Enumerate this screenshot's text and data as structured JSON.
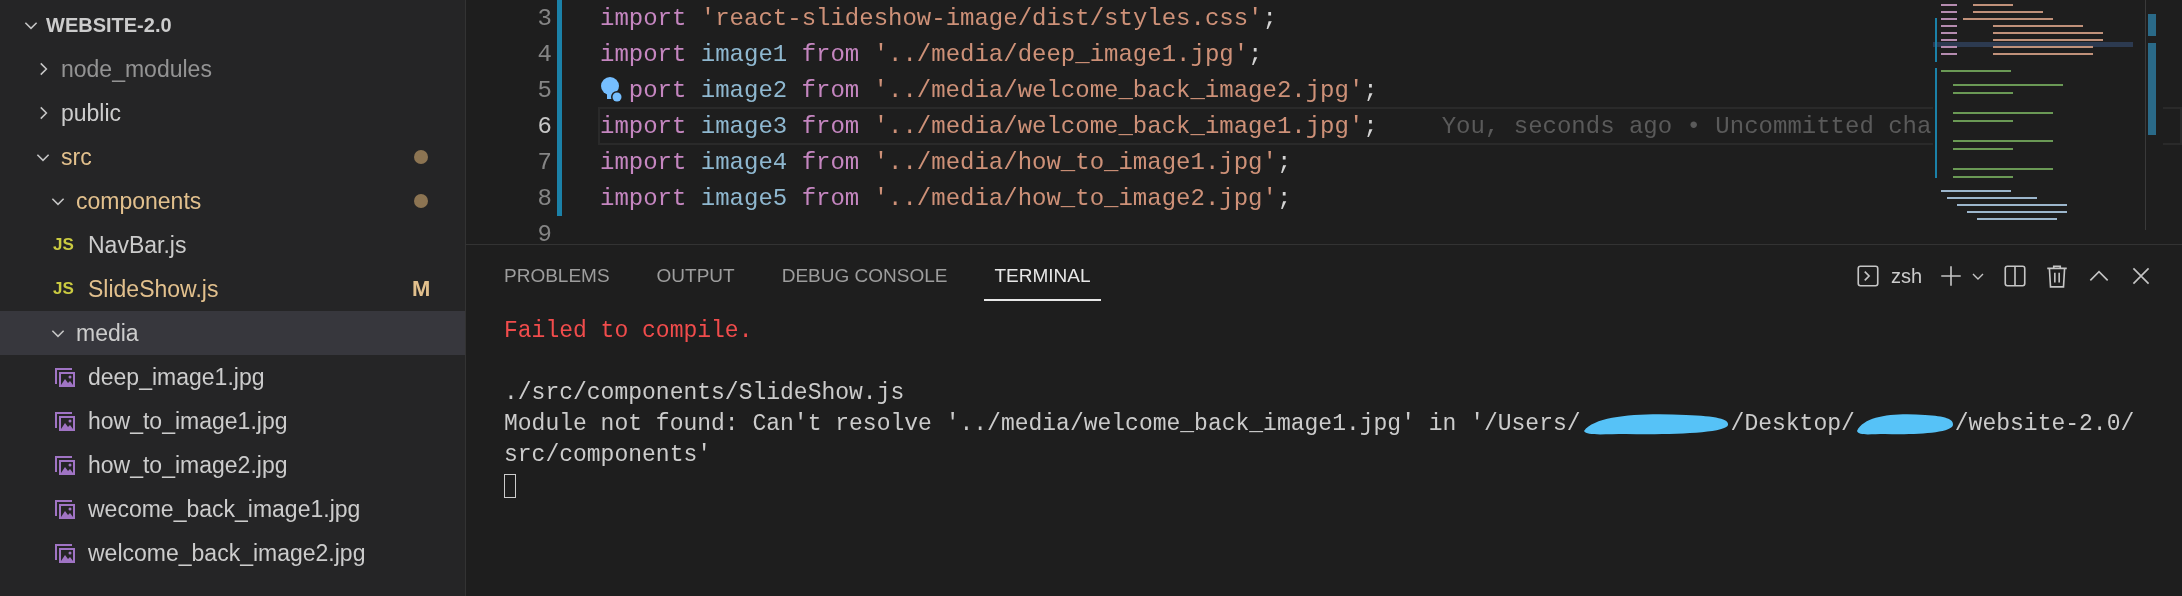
{
  "explorer": {
    "title": "WEBSITE-2.0",
    "expanded": true,
    "items": [
      {
        "name": "node_modules",
        "kind": "folder",
        "expanded": false,
        "ignored": true,
        "modified": false,
        "selected": false
      },
      {
        "name": "public",
        "kind": "folder",
        "expanded": false,
        "ignored": false,
        "modified": false,
        "selected": false
      },
      {
        "name": "src",
        "kind": "folder",
        "expanded": true,
        "ignored": false,
        "modified": true,
        "selected": false,
        "children": [
          {
            "name": "components",
            "kind": "folder",
            "expanded": true,
            "ignored": false,
            "modified": true,
            "selected": false,
            "children": [
              {
                "name": "NavBar.js",
                "kind": "js",
                "icon_label": "JS",
                "ignored": false,
                "modified": false,
                "selected": false
              },
              {
                "name": "SlideShow.js",
                "kind": "js",
                "icon_label": "JS",
                "ignored": false,
                "modified": true,
                "badge": "M",
                "selected": false
              }
            ]
          },
          {
            "name": "media",
            "kind": "folder",
            "expanded": true,
            "ignored": false,
            "modified": false,
            "selected": true,
            "children": [
              {
                "name": "deep_image1.jpg",
                "kind": "image",
                "ignored": false,
                "modified": false,
                "selected": false
              },
              {
                "name": "how_to_image1.jpg",
                "kind": "image",
                "ignored": false,
                "modified": false,
                "selected": false
              },
              {
                "name": "how_to_image2.jpg",
                "kind": "image",
                "ignored": false,
                "modified": false,
                "selected": false
              },
              {
                "name": "wecome_back_image1.jpg",
                "kind": "image",
                "ignored": false,
                "modified": false,
                "selected": false
              },
              {
                "name": "welcome_back_image2.jpg",
                "kind": "image",
                "ignored": false,
                "modified": false,
                "selected": false
              }
            ]
          }
        ]
      }
    ]
  },
  "editor": {
    "lines": [
      {
        "number": "3",
        "active": false,
        "changed": true,
        "tokens": [
          {
            "kind": "keyword",
            "text": "import"
          },
          {
            "kind": "string",
            "text": "'react-slideshow-image/dist/styles.css'"
          },
          {
            "kind": "punct",
            "text": ";"
          }
        ]
      },
      {
        "number": "4",
        "active": false,
        "changed": true,
        "tokens": [
          {
            "kind": "keyword",
            "text": "import"
          },
          {
            "kind": "variable",
            "text": "image1"
          },
          {
            "kind": "keyword",
            "text": "from"
          },
          {
            "kind": "string",
            "text": "'../media/deep_image1.jpg'"
          },
          {
            "kind": "punct",
            "text": ";"
          }
        ]
      },
      {
        "number": "5",
        "active": false,
        "changed": true,
        "lightbulb": true,
        "tokens": [
          {
            "kind": "keyword",
            "text": "port"
          },
          {
            "kind": "variable",
            "text": "image2"
          },
          {
            "kind": "keyword",
            "text": "from"
          },
          {
            "kind": "string",
            "text": "'../media/welcome_back_image2.jpg'"
          },
          {
            "kind": "punct",
            "text": ";"
          }
        ]
      },
      {
        "number": "6",
        "active": true,
        "changed": true,
        "blame": "You, seconds ago • Uncommitted cha",
        "tokens": [
          {
            "kind": "keyword",
            "text": "import"
          },
          {
            "kind": "variable",
            "text": "image3"
          },
          {
            "kind": "keyword",
            "text": "from"
          },
          {
            "kind": "string",
            "text": "'../media/welcome_back_image1.jpg'"
          },
          {
            "kind": "punct",
            "text": ";"
          }
        ]
      },
      {
        "number": "7",
        "active": false,
        "changed": true,
        "tokens": [
          {
            "kind": "keyword",
            "text": "import"
          },
          {
            "kind": "variable",
            "text": "image4"
          },
          {
            "kind": "keyword",
            "text": "from"
          },
          {
            "kind": "string",
            "text": "'../media/how_to_image1.jpg'"
          },
          {
            "kind": "punct",
            "text": ";"
          }
        ]
      },
      {
        "number": "8",
        "active": false,
        "changed": true,
        "tokens": [
          {
            "kind": "keyword",
            "text": "import"
          },
          {
            "kind": "variable",
            "text": "image5"
          },
          {
            "kind": "keyword",
            "text": "from"
          },
          {
            "kind": "string",
            "text": "'../media/how_to_image2.jpg'"
          },
          {
            "kind": "punct",
            "text": ";"
          }
        ]
      },
      {
        "number": "9",
        "active": false
      }
    ]
  },
  "panel": {
    "tabs": [
      {
        "label": "PROBLEMS",
        "selected": false
      },
      {
        "label": "OUTPUT",
        "selected": false
      },
      {
        "label": "DEBUG CONSOLE",
        "selected": false
      },
      {
        "label": "TERMINAL",
        "selected": true
      }
    ],
    "shell": "zsh",
    "lines": [
      {
        "kind": "error",
        "segments": [
          {
            "kind": "text",
            "text": "Failed to compile."
          }
        ]
      },
      {
        "kind": "blank"
      },
      {
        "kind": "plain",
        "segments": [
          {
            "kind": "text",
            "text": "./src/components/SlideShow.js"
          }
        ]
      },
      {
        "kind": "plain",
        "segments": [
          {
            "kind": "text",
            "text": "Module not found: Can't resolve '../media/welcome_back_image1.jpg' in '/Users/"
          },
          {
            "kind": "redaction"
          },
          {
            "kind": "text",
            "text": "/Desktop/"
          },
          {
            "kind": "redaction"
          },
          {
            "kind": "text",
            "text": "/website-2.0/"
          }
        ]
      },
      {
        "kind": "plain",
        "segments": [
          {
            "kind": "text",
            "text": "src/components'"
          }
        ]
      },
      {
        "kind": "cursor"
      }
    ]
  }
}
